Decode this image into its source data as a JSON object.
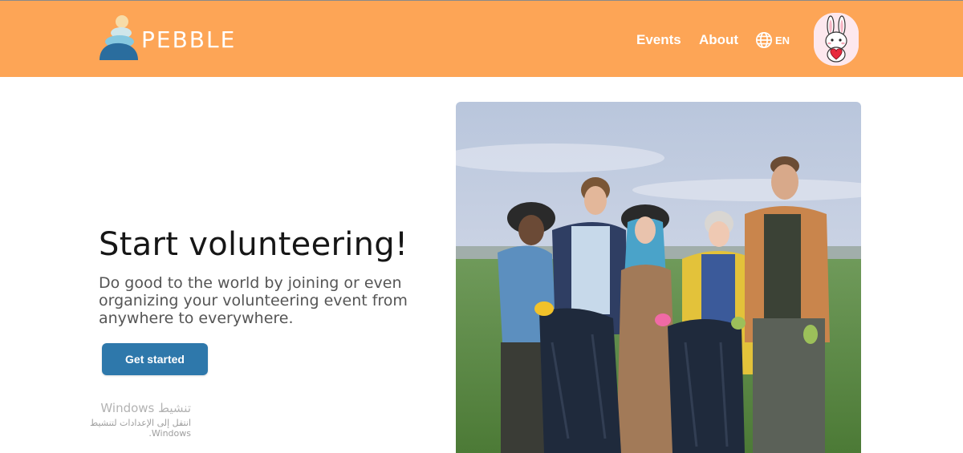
{
  "header": {
    "logo_text": "PEBBLE",
    "nav": {
      "events_label": "Events",
      "about_label": "About",
      "language_label": "EN"
    },
    "avatar_icon": "bunny-holding-heart-icon",
    "background_color": "#fda556"
  },
  "hero": {
    "title": "Start volunteering!",
    "subtitle": "Do good to the world by joining or even organizing your volunteering event from anywhere to everywhere.",
    "cta_label": "Get started",
    "cta_color": "#2e78ab"
  },
  "watermark": {
    "title": "تنشيط Windows",
    "subtitle": "انتقل إلى الإعدادات لتنشيط Windows."
  }
}
